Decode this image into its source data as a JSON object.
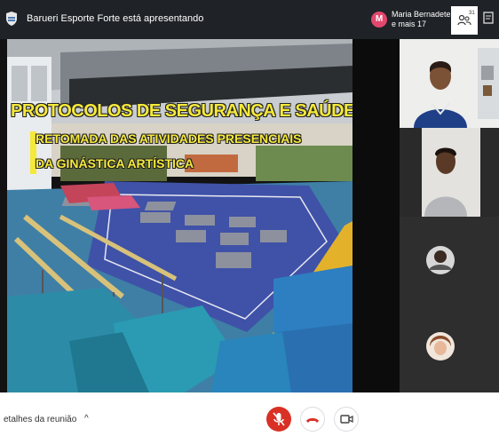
{
  "topbar": {
    "presenter_text": "Barueri Esporte Forte está apresentando",
    "participant_initial": "M",
    "participant_line1": "Maria Bernadete",
    "participant_line2": "e mais 17",
    "people_count": "31"
  },
  "slide": {
    "title": "PROTOCOLOS DE SEGURANÇA E SAÚDE PÚBLICA",
    "subtitle_line1": "RETOMADA DAS ATIVIDADES PRESENCIAIS",
    "subtitle_line2": "DA GINÁSTICA ARTÍSTICA"
  },
  "bottombar": {
    "details_label": "etalhes da reunião",
    "caret": "^"
  },
  "colors": {
    "accent_avatar": "#e2476d",
    "mic_off": "#d93025",
    "slide_text": "#f5e93a"
  },
  "icons": [
    "presenter-shield-icon",
    "people-icon",
    "chat-icon",
    "mic-off-icon",
    "end-call-icon",
    "camera-icon"
  ]
}
